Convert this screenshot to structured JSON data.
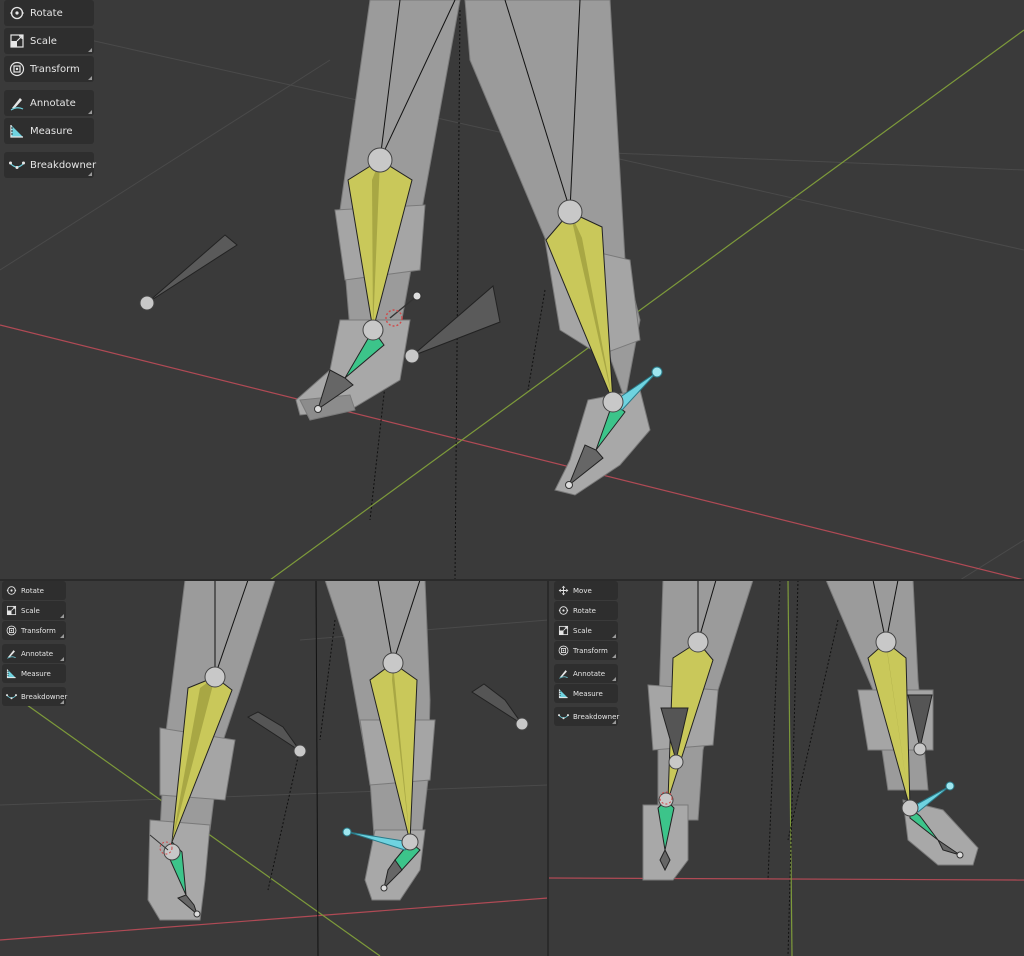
{
  "viewports": {
    "top": {
      "tools": [
        {
          "label": "Rotate",
          "icon": "rotate-icon"
        },
        {
          "label": "Scale",
          "icon": "scale-icon"
        },
        {
          "label": "Transform",
          "icon": "transform-icon"
        },
        {
          "label": "Annotate",
          "icon": "annotate-icon"
        },
        {
          "label": "Measure",
          "icon": "measure-icon"
        },
        {
          "label": "Breakdowner",
          "icon": "breakdowner-icon"
        }
      ]
    },
    "bottom_left": {
      "tools": [
        {
          "label": "Rotate",
          "icon": "rotate-icon"
        },
        {
          "label": "Scale",
          "icon": "scale-icon"
        },
        {
          "label": "Transform",
          "icon": "transform-icon"
        },
        {
          "label": "Annotate",
          "icon": "annotate-icon"
        },
        {
          "label": "Measure",
          "icon": "measure-icon"
        },
        {
          "label": "Breakdowner",
          "icon": "breakdowner-icon"
        }
      ]
    },
    "bottom_right": {
      "tools": [
        {
          "label": "Move",
          "icon": "move-icon"
        },
        {
          "label": "Rotate",
          "icon": "rotate-icon"
        },
        {
          "label": "Scale",
          "icon": "scale-icon"
        },
        {
          "label": "Transform",
          "icon": "transform-icon"
        },
        {
          "label": "Annotate",
          "icon": "annotate-icon"
        },
        {
          "label": "Measure",
          "icon": "measure-icon"
        },
        {
          "label": "Breakdowner",
          "icon": "breakdowner-icon"
        }
      ]
    }
  },
  "colors": {
    "viewport_bg": "#3a3a3a",
    "grid_line": "#4a4a4a",
    "x_axis": "#b04a55",
    "y_axis": "#7d9a3a",
    "mesh": "#9a9a9a",
    "bone_yellow": "#c9c85a",
    "bone_green": "#3cc48a",
    "bone_cyan": "#6fd3e0",
    "toolbar_bg": "#2e2e2e",
    "toolbar_text": "#e6e6e6"
  }
}
